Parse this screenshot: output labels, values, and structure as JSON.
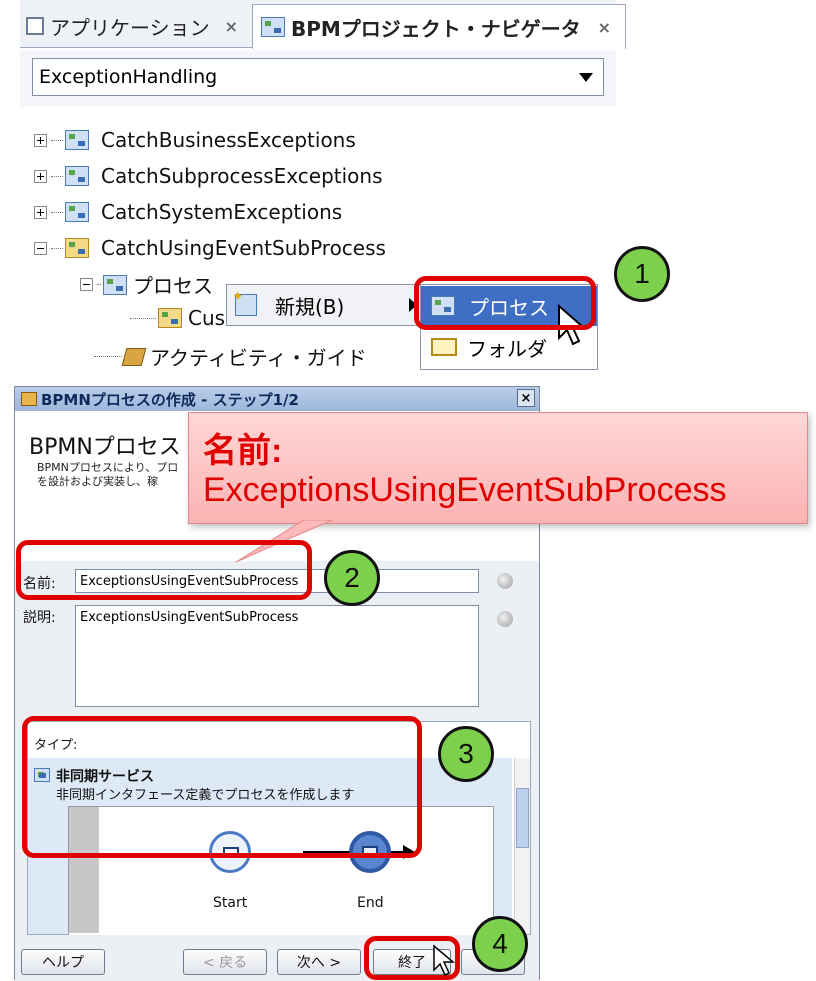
{
  "tabs": [
    {
      "label": "アプリケーション",
      "close": "×"
    },
    {
      "label": "BPMプロジェクト・ナビゲータ",
      "close": "×"
    }
  ],
  "project_select": {
    "value": "ExceptionHandling"
  },
  "tree": {
    "items": [
      "CatchBusinessExceptions",
      "CatchSubprocessExceptions",
      "CatchSystemExceptions",
      "CatchUsingEventSubProcess"
    ],
    "process_folder": "プロセス",
    "child_partial": "Cus",
    "activity_guide": "アクティビティ・ガイド"
  },
  "context_menu": {
    "new_label": "新規(B)",
    "submenu": {
      "process": "プロセス",
      "folder": "フォルダ"
    }
  },
  "dialog": {
    "title": "BPMNプロセスの作成 - ステップ1/2",
    "close": "×",
    "header_title": "BPMNプロセス",
    "header_desc": "BPMNプロセスにより、プロ\nを設計および実装し、稼",
    "name_label": "名前:",
    "name_value": "ExceptionsUsingEventSubProcess",
    "desc_label": "説明:",
    "desc_value": "ExceptionsUsingEventSubProcess",
    "type_label": "タイプ:",
    "type_option_title": "非同期サービス",
    "type_option_desc": "非同期インタフェース定義でプロセスを作成します",
    "start_label": "Start",
    "end_label": "End",
    "buttons": {
      "help": "ヘルプ",
      "back": "< 戻る",
      "next": "次へ >",
      "finish": "終了"
    }
  },
  "annotations": {
    "badges": [
      "1",
      "2",
      "3",
      "4"
    ],
    "callout_label": "名前:",
    "callout_value": "ExceptionsUsingEventSubProcess"
  },
  "colors": {
    "highlight_red": "#e00000",
    "badge_green": "#7cd04c",
    "selection_blue": "#3f6fc4"
  }
}
